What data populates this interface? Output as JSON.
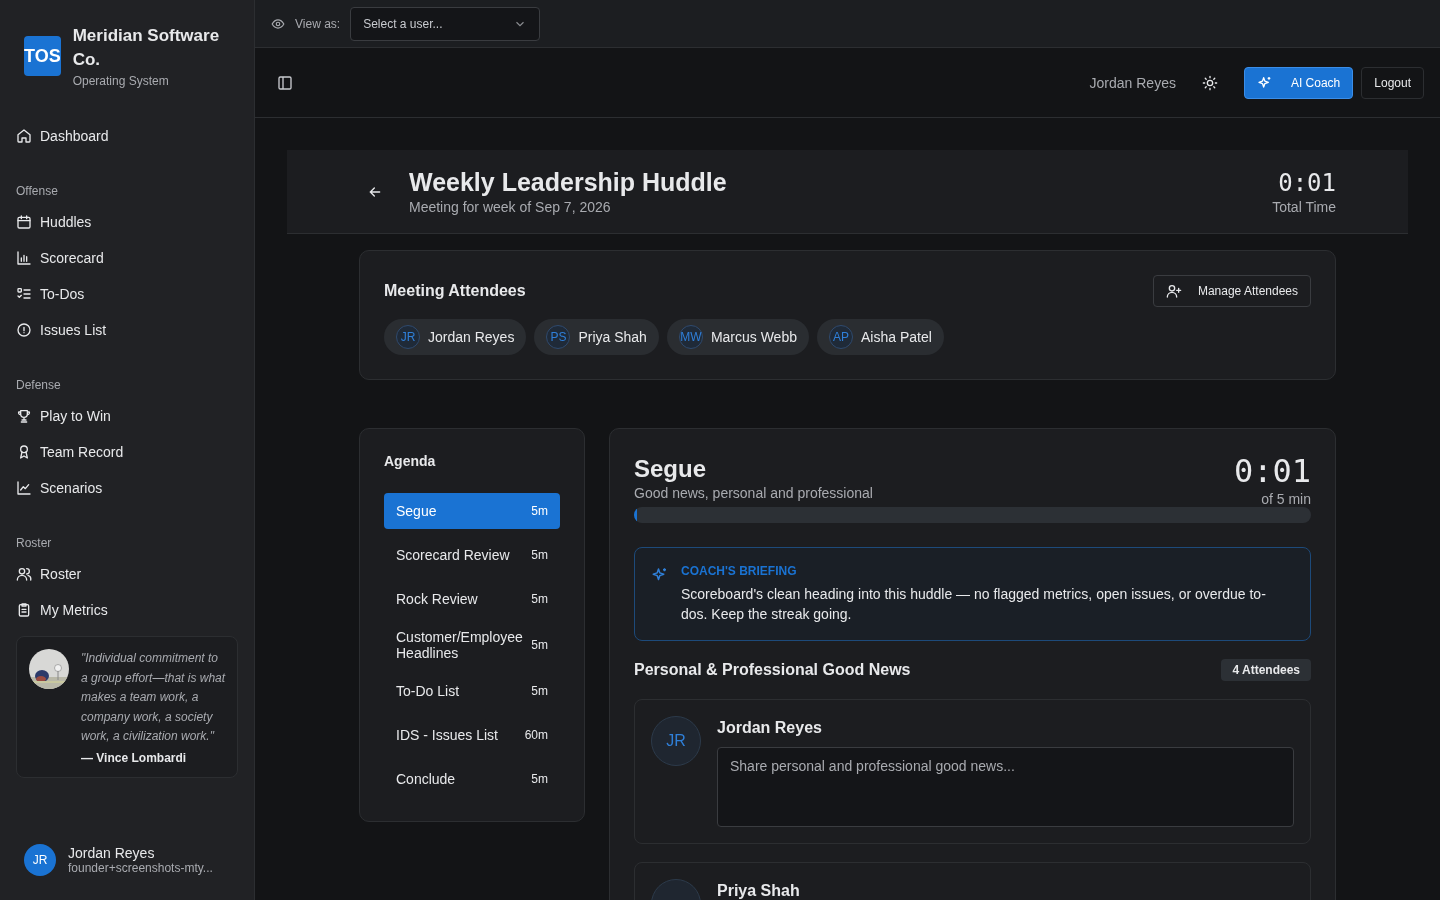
{
  "sidebar": {
    "brand": {
      "logo": "TOS",
      "name": "Meridian Software Co.",
      "subtitle": "Operating System"
    },
    "sections": [
      {
        "items": [
          "Dashboard"
        ]
      },
      {
        "label": "Offense",
        "items": [
          "Huddles",
          "Scorecard",
          "To-Dos",
          "Issues List"
        ]
      },
      {
        "label": "Defense",
        "items": [
          "Play to Win",
          "Team Record",
          "Scenarios"
        ]
      },
      {
        "label": "Roster",
        "items": [
          "Roster",
          "My Metrics"
        ]
      }
    ],
    "quote": {
      "text": "\"Individual commitment to a group effort—that is what makes a team work, a company work, a society work, a civilization work.\"",
      "author": "— Vince Lombardi"
    },
    "user": {
      "initials": "JR",
      "name": "Jordan Reyes",
      "email": "founder+screenshots-mty..."
    }
  },
  "view_as": {
    "label": "View as:",
    "placeholder": "Select a user..."
  },
  "header": {
    "user": "Jordan Reyes",
    "ai_button": "AI Coach",
    "logout": "Logout"
  },
  "meeting": {
    "title": "Weekly Leadership Huddle",
    "subtitle": "Meeting for week of Sep 7, 2026",
    "total_time": "0:01",
    "total_label": "Total Time"
  },
  "attendees": {
    "title": "Meeting Attendees",
    "manage": "Manage Attendees",
    "people": [
      {
        "initials": "JR",
        "name": "Jordan Reyes"
      },
      {
        "initials": "PS",
        "name": "Priya Shah"
      },
      {
        "initials": "MW",
        "name": "Marcus Webb"
      },
      {
        "initials": "AP",
        "name": "Aisha Patel"
      }
    ]
  },
  "agenda": {
    "title": "Agenda",
    "items": [
      {
        "title": "Segue",
        "duration": "5m",
        "selected": true
      },
      {
        "title": "Scorecard Review",
        "duration": "5m",
        "selected": false
      },
      {
        "title": "Rock Review",
        "duration": "5m",
        "selected": false
      },
      {
        "title": "Customer/Employee Headlines",
        "duration": "5m",
        "selected": false
      },
      {
        "title": "To-Do List",
        "duration": "5m",
        "selected": false
      },
      {
        "title": "IDS - Issues List",
        "duration": "60m",
        "selected": false
      },
      {
        "title": "Conclude",
        "duration": "5m",
        "selected": false
      }
    ]
  },
  "section": {
    "title": "Segue",
    "subtitle": "Good news, personal and professional",
    "timer": "0:01",
    "timer_of": "of 5 min",
    "level": 0.004,
    "briefing": {
      "label": "COACH'S BRIEFING",
      "text": "Scoreboard's clean heading into this huddle — no flagged metrics, open issues, or overdue to-dos. Keep the streak going."
    },
    "news_title": "Personal & Professional Good News",
    "count": "4 Attendees",
    "entries": [
      {
        "initials": "JR",
        "name": "Jordan Reyes",
        "placeholder": "Share personal and professional good news..."
      },
      {
        "name": "Priya Shah"
      }
    ]
  }
}
